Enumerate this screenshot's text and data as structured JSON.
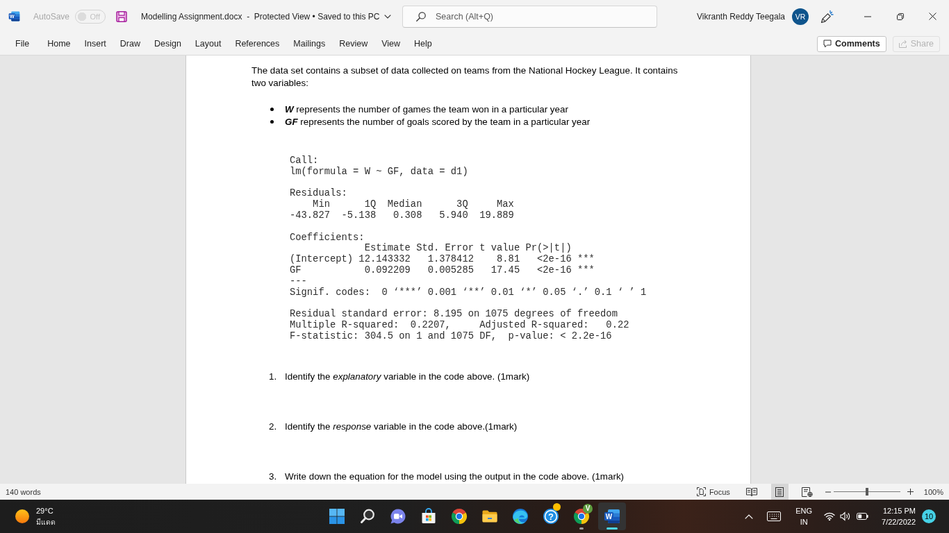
{
  "title_bar": {
    "app_icon": {
      "letter": "W"
    },
    "autosave": {
      "label": "AutoSave",
      "state_label": "Off",
      "on": false,
      "disabled": true
    },
    "document_title": "Modelling Assignment.docx  -  Protected View • Saved to this PC",
    "search": {
      "placeholder": "Search (Alt+Q)"
    },
    "user": {
      "name": "Vikranth Reddy Teegala",
      "initials": "VR"
    }
  },
  "ribbon": {
    "tabs": [
      {
        "label": "File",
        "selected": false
      },
      {
        "label": "Home",
        "selected": false
      },
      {
        "label": "Insert",
        "selected": false
      },
      {
        "label": "Draw",
        "selected": false
      },
      {
        "label": "Design",
        "selected": false
      },
      {
        "label": "Layout",
        "selected": false
      },
      {
        "label": "References",
        "selected": false
      },
      {
        "label": "Mailings",
        "selected": false
      },
      {
        "label": "Review",
        "selected": false
      },
      {
        "label": "View",
        "selected": false
      },
      {
        "label": "Help",
        "selected": false
      }
    ],
    "comments_button": {
      "label": "Comments"
    },
    "share_button": {
      "label": "Share",
      "disabled": true
    }
  },
  "document": {
    "intro": "The data set contains a subset of data collected on teams from the National Hockey League. It contains two variables:",
    "bullets": [
      "**W** represents the number of games the team won in a particular year",
      "**GF** represents the number of goals scored by the team in a particular year"
    ],
    "code_output": [
      [
        "Call:",
        "lm(formula = W ~ GF, data = d1)"
      ],
      [
        "Residuals:",
        "    Min      1Q  Median      3Q     Max",
        "-43.827  -5.138   0.308   5.940  19.889"
      ],
      [
        "Coefficients:",
        "             Estimate Std. Error t value Pr(>|t|)",
        "(Intercept) 12.143332   1.378412    8.81   <2e-16 ***",
        "GF           0.092209   0.005285   17.45   <2e-16 ***",
        "---",
        "Signif. codes:  0 ‘***’ 0.001 ‘**’ 0.01 ‘*’ 0.05 ‘.’ 0.1 ‘ ’ 1"
      ],
      [
        "Residual standard error: 8.195 on 1075 degrees of freedom",
        "Multiple R-squared:  0.2207,     Adjusted R-squared:   0.22",
        "F-statistic: 304.5 on 1 and 1075 DF,  p-value: < 2.2e-16"
      ]
    ],
    "questions": [
      {
        "number": "1.",
        "text": "Identify the *explanatory* variable in the code above. (1mark)"
      },
      {
        "number": "2.",
        "text": "Identify the *response* variable in the code above.(1mark)"
      },
      {
        "number": "3.",
        "text": "Write down the equation for the model using the output in the code above. (1mark)"
      }
    ]
  },
  "status_bar": {
    "word_count": "140 words",
    "focus_label": "Focus",
    "view_buttons": [
      {
        "kind": "read",
        "selected": false
      },
      {
        "kind": "print",
        "selected": true
      },
      {
        "kind": "web",
        "selected": false
      }
    ],
    "zoom": {
      "level": 0.5,
      "reading": "100%"
    }
  },
  "taskbar": {
    "weather": {
      "temperature": "29°C",
      "condition": "มีแดด"
    },
    "apps": [
      {
        "kind": "start",
        "running": false,
        "active": false,
        "notification": false
      },
      {
        "kind": "search",
        "running": false,
        "active": false,
        "notification": false
      },
      {
        "kind": "chat",
        "running": false,
        "active": false,
        "notification": false
      },
      {
        "kind": "store",
        "running": false,
        "active": false,
        "notification": false
      },
      {
        "kind": "browser",
        "running": false,
        "active": false,
        "notification": false
      },
      {
        "kind": "files",
        "running": false,
        "active": false,
        "notification": false
      },
      {
        "kind": "web",
        "running": false,
        "active": false,
        "notification": false
      },
      {
        "kind": "help",
        "symbol": "?",
        "running": false,
        "active": false,
        "notification": true
      },
      {
        "kind": "browser",
        "badge": "V",
        "running": true,
        "active": false,
        "notification": false
      },
      {
        "kind": "document",
        "letter": "W",
        "running": true,
        "active": true,
        "notification": false
      }
    ],
    "tray": {
      "language": "ENG",
      "region": "IN",
      "time": "12:15 PM",
      "date": "7/22/2022",
      "notification_count": "10"
    }
  }
}
